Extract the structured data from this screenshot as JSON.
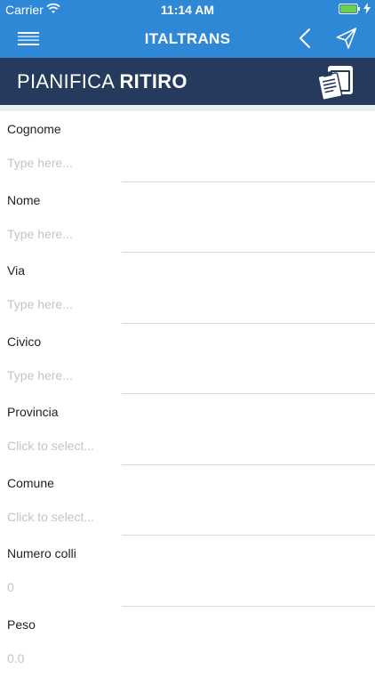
{
  "status_bar": {
    "carrier": "Carrier",
    "time": "11:14 AM"
  },
  "nav": {
    "title": "ITALTRANS",
    "accent_color": "#2f88d6"
  },
  "header": {
    "title_light": "PIANIFICA",
    "title_bold": "RITIRO",
    "color": "#253a5c"
  },
  "form": {
    "cognome": {
      "label": "Cognome",
      "placeholder": "Type here..."
    },
    "nome": {
      "label": "Nome",
      "placeholder": "Type here..."
    },
    "via": {
      "label": "Via",
      "placeholder": "Type here..."
    },
    "civico": {
      "label": "Civico",
      "placeholder": "Type here..."
    },
    "provincia": {
      "label": "Provincia",
      "placeholder": "Click to select..."
    },
    "comune": {
      "label": "Comune",
      "placeholder": "Click to select..."
    },
    "numero_colli": {
      "label": "Numero colli",
      "value": "0"
    },
    "peso": {
      "label": "Peso",
      "value": "0.0"
    }
  }
}
